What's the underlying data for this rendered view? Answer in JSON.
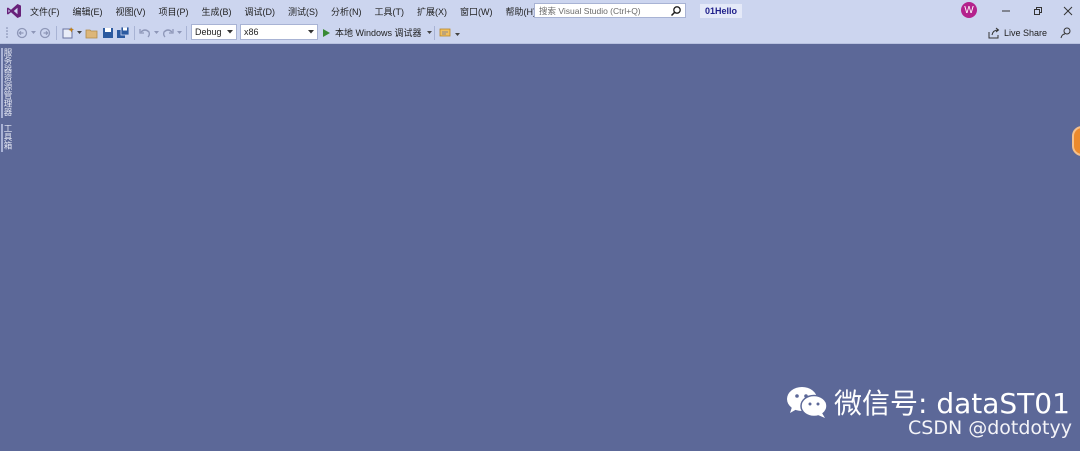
{
  "menu": {
    "items": [
      "文件(F)",
      "编辑(E)",
      "视图(V)",
      "项目(P)",
      "生成(B)",
      "调试(D)",
      "测试(S)",
      "分析(N)",
      "工具(T)",
      "扩展(X)",
      "窗口(W)",
      "帮助(H)"
    ]
  },
  "search": {
    "placeholder": "搜索 Visual Studio (Ctrl+Q)"
  },
  "solution": {
    "name": "01Hello"
  },
  "account": {
    "initial": "W",
    "color": "#b4228c"
  },
  "toolbar": {
    "configuration": "Debug",
    "platform": "x86",
    "run_label": "本地 Windows 调试器",
    "live_share_label": "Live Share"
  },
  "side_tabs": [
    "服务器资源管理器",
    "工具箱"
  ],
  "watermark": {
    "wechat": "微信号: dataST01",
    "csdn": "CSDN @dotdotyy"
  },
  "colors": {
    "workspace": "#5c6898",
    "chrome": "#ccd5ef",
    "accent_orange": "#ec8a2c"
  }
}
